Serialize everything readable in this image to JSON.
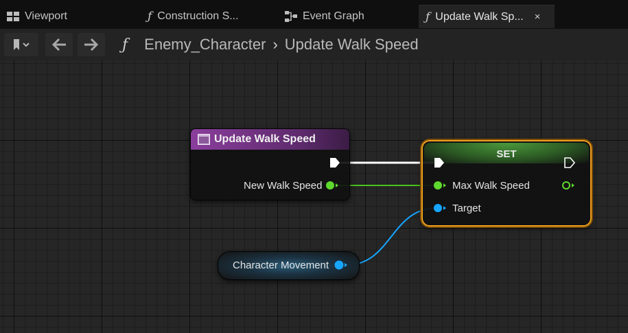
{
  "tabs": [
    {
      "label": "Viewport",
      "icon": "viewport-icon"
    },
    {
      "label": "Construction S...",
      "icon": "function-icon"
    },
    {
      "label": "Event Graph",
      "icon": "event-graph-icon"
    },
    {
      "label": "Update Walk Sp...",
      "icon": "function-icon",
      "close": "×"
    }
  ],
  "toolbar": {
    "breadcrumb": [
      "Enemy_Character",
      "Update Walk Speed"
    ],
    "separator": "›"
  },
  "nodes": {
    "entry": {
      "title": "Update Walk Speed",
      "color": "#7b3c8c",
      "output_pin": "New Walk Speed"
    },
    "set": {
      "title": "SET",
      "color": "#3e8a3e",
      "highlight": "#f0a020",
      "input_pins": [
        "Max Walk Speed",
        "Target"
      ]
    },
    "getter": {
      "title": "Character Movement",
      "pin_color": "#16a6ff"
    }
  },
  "colors": {
    "float_pin": "#5fd92d",
    "object_pin": "#16a6ff",
    "exec_pin": "#ffffff"
  }
}
